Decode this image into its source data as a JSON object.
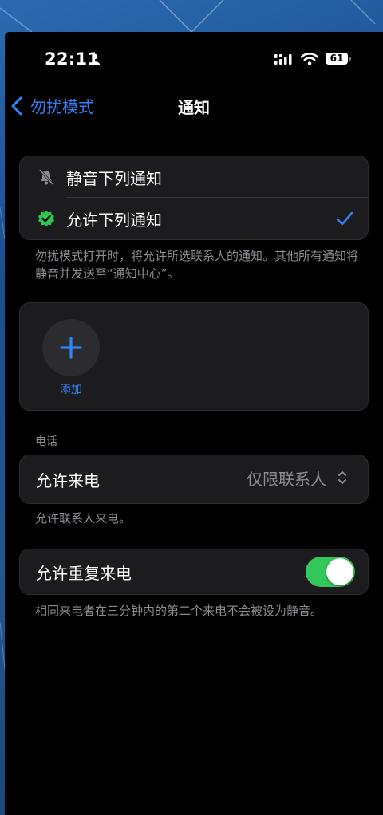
{
  "status_bar": {
    "time": "22:11",
    "battery": "61",
    "icons": [
      "person-icon",
      "cellular-signal-icon",
      "wifi-icon",
      "battery-icon"
    ]
  },
  "nav": {
    "back_label": "勿扰模式",
    "title": "通知"
  },
  "notify_options": {
    "items": [
      {
        "label": "静音下列通知",
        "icon": "bell-slash-icon"
      },
      {
        "label": "允许下列通知",
        "icon": "verified-check-icon",
        "selected": true
      }
    ],
    "footer": "勿扰模式打开时，将允许所选联系人的通知。其他所有通知将静音并发送至“通知中心”。"
  },
  "people": {
    "add_label": "添加"
  },
  "phone_section": {
    "header": "电话",
    "allow_calls_label": "允许来电",
    "allow_calls_value": "仅限联系人",
    "allow_calls_footer": "允许联系人来电。",
    "repeated_calls_label": "允许重复来电",
    "repeated_calls_on": true,
    "repeated_calls_footer": "相同来电者在三分钟内的第二个来电不会被设为静音。"
  },
  "colors": {
    "accent": "#2f84f7",
    "toggle_on": "#34c759",
    "verified_green": "#30c552",
    "cell_bg": "#1c1c1e",
    "secondary_text": "#8d8d93"
  }
}
